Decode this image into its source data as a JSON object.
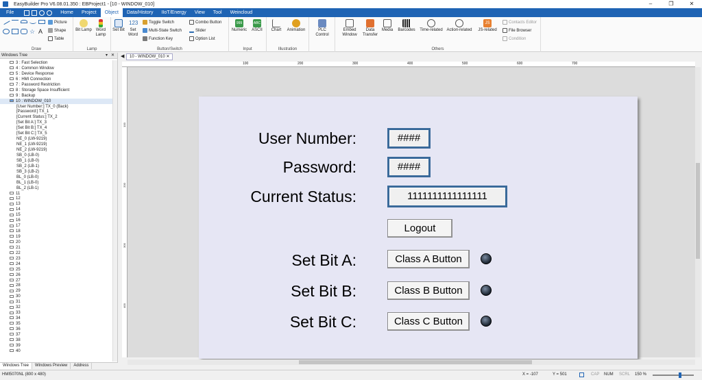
{
  "title_bar": {
    "title": "EasyBuilder Pro V6.08.01.350 : EBProject1 - [10 - WINDOW_010]",
    "minimize": "–",
    "restore": "❐",
    "close": "✕"
  },
  "menu": {
    "tabs": [
      "File",
      "Home",
      "Project",
      "Object",
      "Data/History",
      "IIoT/Energy",
      "View",
      "Tool",
      "Weincloud"
    ],
    "active": "Object"
  },
  "ribbon": {
    "draw": {
      "label": "Draw",
      "picture": "Picture",
      "shape": "Shape",
      "table": "Table"
    },
    "lamp": {
      "label": "Lamp",
      "bit_lamp": "Bit Lamp",
      "word_lamp": "Word Lamp"
    },
    "button_switch": {
      "label": "Button/Switch",
      "set_bit": "Set Bit",
      "set_word": "Set Word",
      "toggle_switch": "Toggle Switch",
      "multi_state_switch": "Multi-State Switch",
      "function_key": "Function Key",
      "combo_button": "Combo Button",
      "slider": "Slider",
      "option_list": "Option List"
    },
    "input": {
      "label": "Input",
      "numeric": "Numeric",
      "ascii": "ASCII"
    },
    "illustration": {
      "label": "Illustration",
      "chart": "Chart",
      "animation": "Animation"
    },
    "plc": {
      "plc_control": "PLC Control"
    },
    "others": {
      "label": "Others",
      "embed_window": "Embed Window",
      "data_transfer": "Data Transfer",
      "media": "Media",
      "barcodes": "Barcodes",
      "time_related": "Time-related",
      "action_related": "Action-related",
      "js_related": "JS-related",
      "contacts_editor": "Contacts Editor",
      "file_browser": "File Browser",
      "condition": "Condition"
    }
  },
  "window_tree": {
    "header": "Windows Tree",
    "items": [
      "3 : Fast Selection",
      "4 : Common Window",
      "5 : Device Response",
      "6 : HMI Connection",
      "7 : Password Restriction",
      "8 : Storage Space Insufficient",
      "9 : Backup",
      "10 : WINDOW_010",
      "[User Number:] TX_0 (Back)",
      "[Password:] TX_1",
      "[Current Status:] TX_2",
      "[Set Bit A:] TX_3",
      "[Set Bit B:] TX_4",
      "[Set Bit C:] TX_5",
      "NE_0 (LW-9219)",
      "NE_1 (LW-9219)",
      "NE_2 (LW-9219)",
      "SB_0 (LB-0)",
      "SB_1 (LB-0)",
      "SB_2 (LB-1)",
      "SB_3 (LB-2)",
      "BL_0 (LB-0)",
      "BL_1 (LB-0)",
      "BL_2 (LB-1)",
      "11",
      "12",
      "13",
      "14",
      "15",
      "16",
      "17",
      "18",
      "19",
      "20",
      "21",
      "22",
      "23",
      "24",
      "25",
      "26",
      "27",
      "28",
      "29",
      "30",
      "31",
      "32",
      "33",
      "34",
      "35",
      "36",
      "37",
      "38",
      "39",
      "40"
    ],
    "tabs": [
      "Windows Tree",
      "Windows Preview",
      "Address"
    ]
  },
  "doc": {
    "tab": "10 - WINDOW_010",
    "ruler_marks": [
      "100",
      "200",
      "300",
      "400",
      "500",
      "600",
      "700"
    ],
    "vruler_marks": [
      "100",
      "200",
      "300",
      "400"
    ]
  },
  "screen": {
    "user_number_label": "User Number:",
    "password_label": "Password:",
    "current_status_label": "Current Status:",
    "user_number_value": "####",
    "password_value": "####",
    "current_status_value": "1111111111111111",
    "logout": "Logout",
    "set_bit_a": "Set Bit A:",
    "set_bit_b": "Set Bit B:",
    "set_bit_c": "Set Bit C:",
    "class_a": "Class A Button",
    "class_b": "Class B Button",
    "class_c": "Class C Button"
  },
  "status": {
    "device": "HMI5070NL (800 x 480)",
    "x": "X = -107",
    "y": "Y = 501",
    "cap": "CAP",
    "num": "NUM",
    "scrl": "SCRL",
    "zoom": "150 %"
  }
}
